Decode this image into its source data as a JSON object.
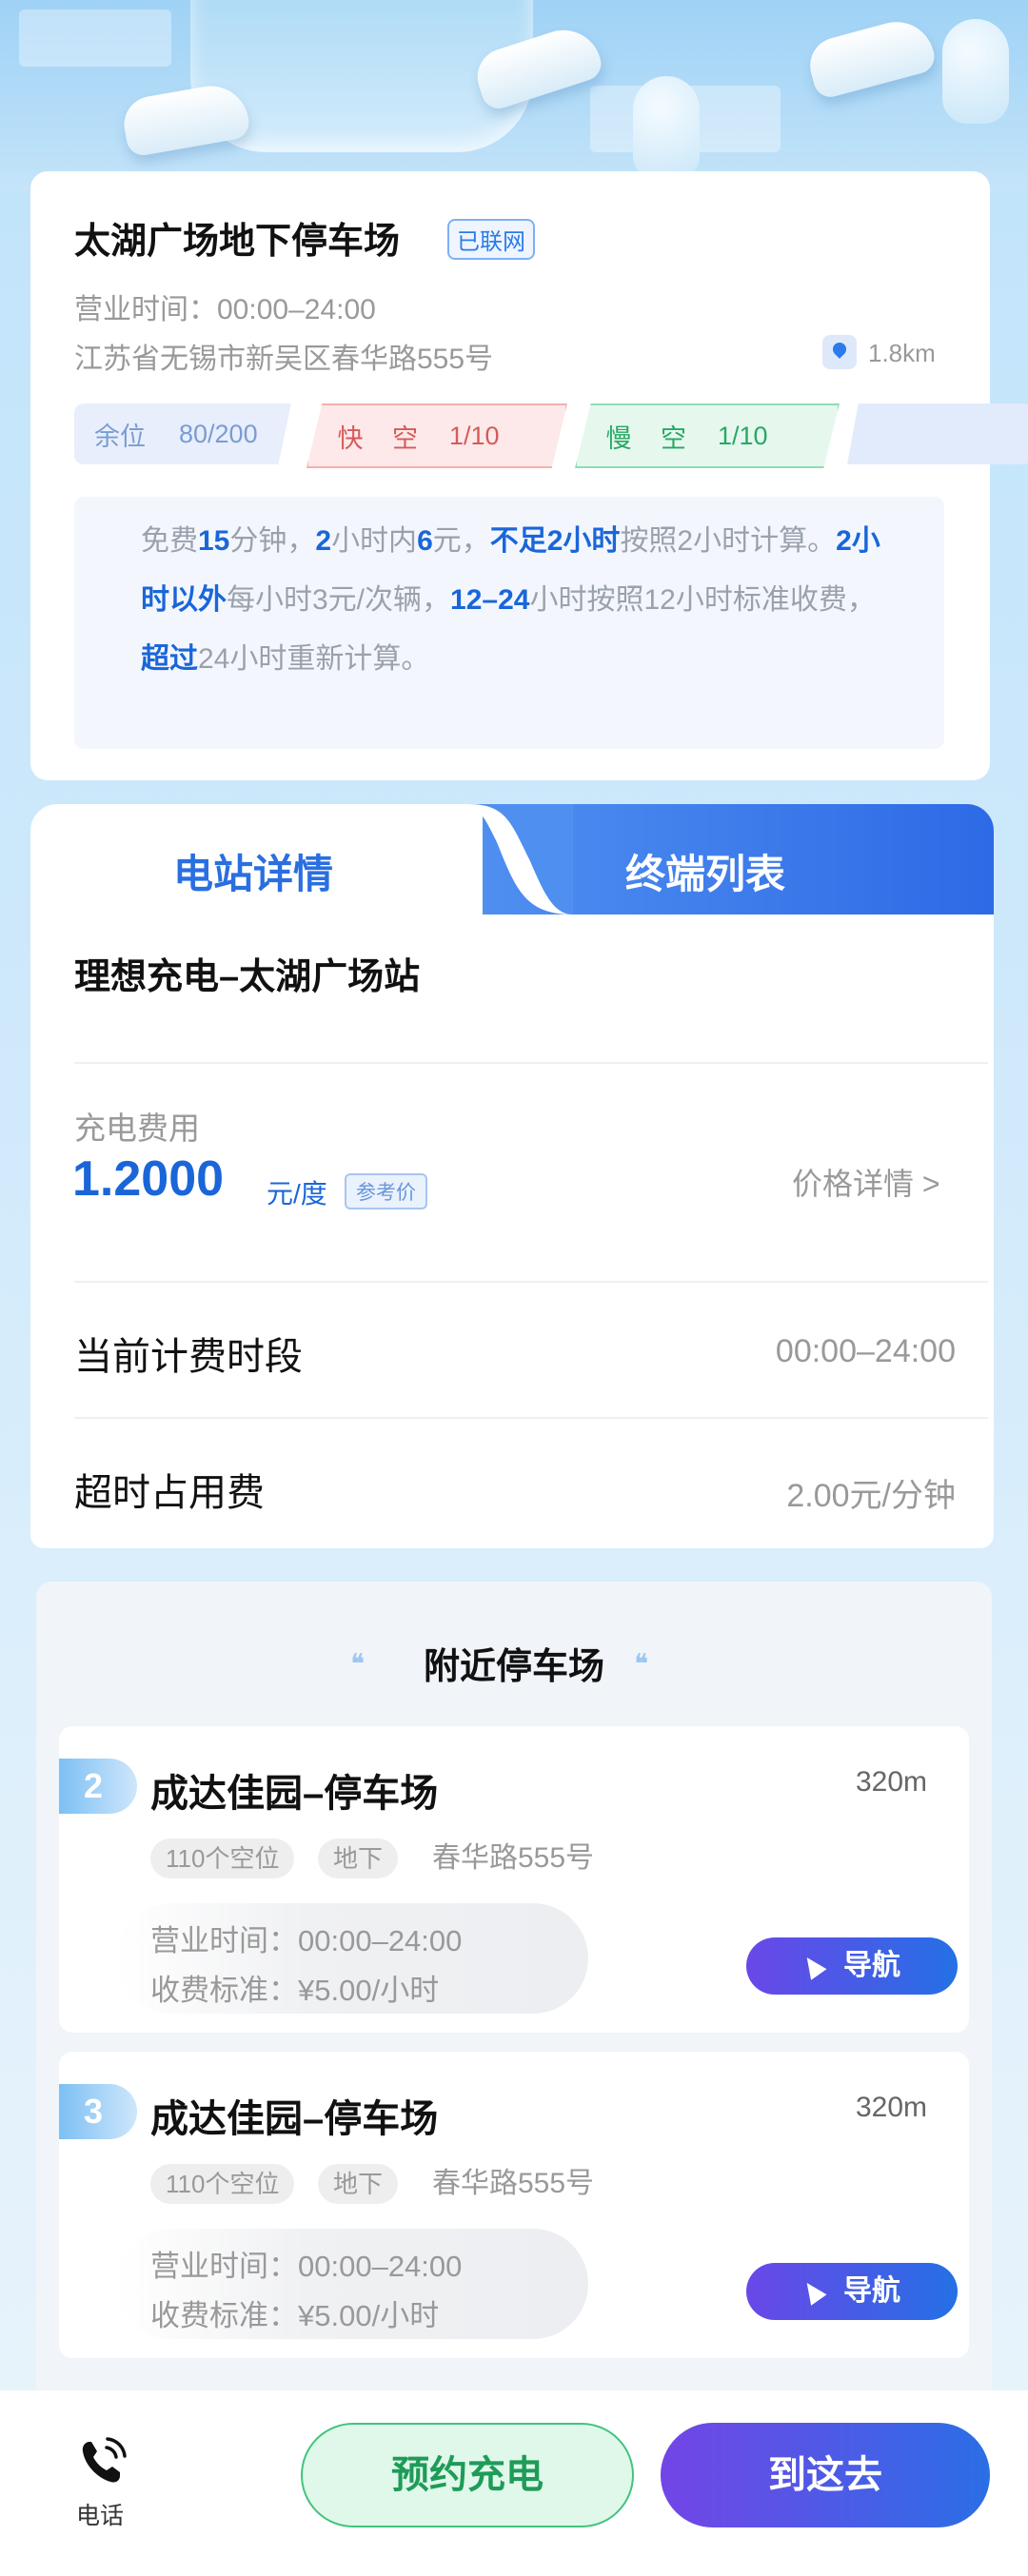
{
  "parking": {
    "name": "太湖广场地下停车场",
    "online_tag": "已联网",
    "hours": "营业时间：00:00–24:00",
    "address": "江苏省无锡市新吴区春华路555号",
    "distance": "1.8km",
    "spaces": {
      "label": "余位",
      "value": "80/200"
    },
    "fast": {
      "label": "快",
      "status": "空",
      "value": "1/10"
    },
    "slow": {
      "label": "慢",
      "status": "空",
      "value": "1/10"
    },
    "fee_rule": {
      "p1": "免费",
      "b1": "15",
      "p2": "分钟，",
      "b2": "2",
      "p3": "小时内",
      "b3": "6",
      "p4": "元，",
      "b4": "不足2小时",
      "p5": "按照2小时计算。",
      "b5": "2小时以外",
      "p6": "每小时3元/次辆，",
      "b6": "12–24",
      "p7": "小时按照12小时标准收费，",
      "b7": "超过",
      "p8": "24小时重新计算。"
    }
  },
  "tabs": {
    "station_detail": "电站详情",
    "terminal_list": "终端列表"
  },
  "station": {
    "name": "理想充电–太湖广场站",
    "fee_label": "充电费用",
    "price": "1.2000",
    "price_unit": "元/度",
    "ref_tag": "参考价",
    "price_detail": "价格详情 >",
    "period_label": "当前计费时段",
    "period_value": "00:00–24:00",
    "overtime_label": "超时占用费",
    "overtime_value": "2.00元/分钟"
  },
  "nearby": {
    "title": "附近停车场",
    "items": [
      {
        "rank": "2",
        "name": "成达佳园–停车场",
        "distance": "320m",
        "chips": [
          "110个空位",
          "地下"
        ],
        "road": "春华路555号",
        "hours_key": "营业时间：",
        "hours_val": "00:00–24:00",
        "fee_key": "收费标准：",
        "fee_val": "¥5.00/小时",
        "nav": "导航"
      },
      {
        "rank": "3",
        "name": "成达佳园–停车场",
        "distance": "320m",
        "chips": [
          "110个空位",
          "地下"
        ],
        "road": "春华路555号",
        "hours_key": "营业时间：",
        "hours_val": "00:00–24:00",
        "fee_key": "收费标准：",
        "fee_val": "¥5.00/小时",
        "nav": "导航"
      }
    ]
  },
  "bottom": {
    "phone": "电话",
    "reserve": "预约充电",
    "go": "到这去"
  },
  "colors": {
    "accent": "#1a66d9",
    "green": "#27a865",
    "red": "#d65a5a",
    "purple": "#6a47e8"
  },
  "icons": [
    "location-pin-icon",
    "navigation-arrow-icon",
    "phone-icon",
    "water-drop-icon"
  ]
}
